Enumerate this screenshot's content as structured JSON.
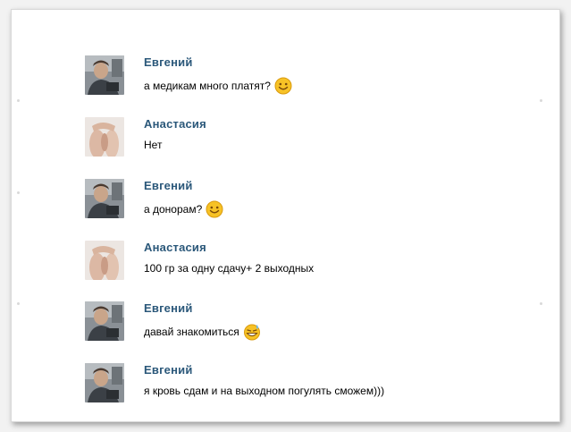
{
  "messages": [
    {
      "author": "Евгений",
      "avatar": "man-avatar",
      "text": "а медикам много платят?",
      "emoji": "smile-emoji"
    },
    {
      "author": "Анастасия",
      "avatar": "woman-avatar",
      "text": "Нет",
      "emoji": ""
    },
    {
      "author": "Евгений",
      "avatar": "man-avatar",
      "text": "а донорам?",
      "emoji": "smile-emoji"
    },
    {
      "author": "Анастасия",
      "avatar": "woman-avatar",
      "text": "100 гр за одну сдачу+ 2 выходных",
      "emoji": ""
    },
    {
      "author": "Евгений",
      "avatar": "man-avatar",
      "text": "давай знакомиться",
      "emoji": "grin-sweat-emoji"
    },
    {
      "author": "Евгений",
      "avatar": "man-avatar",
      "text": "я кровь сдам и на выходном погулять сможем)))",
      "emoji": ""
    }
  ],
  "colors": {
    "author": "#2b587a",
    "text": "#000000",
    "background": "#ffffff",
    "emoji_face": "#f7c226"
  }
}
